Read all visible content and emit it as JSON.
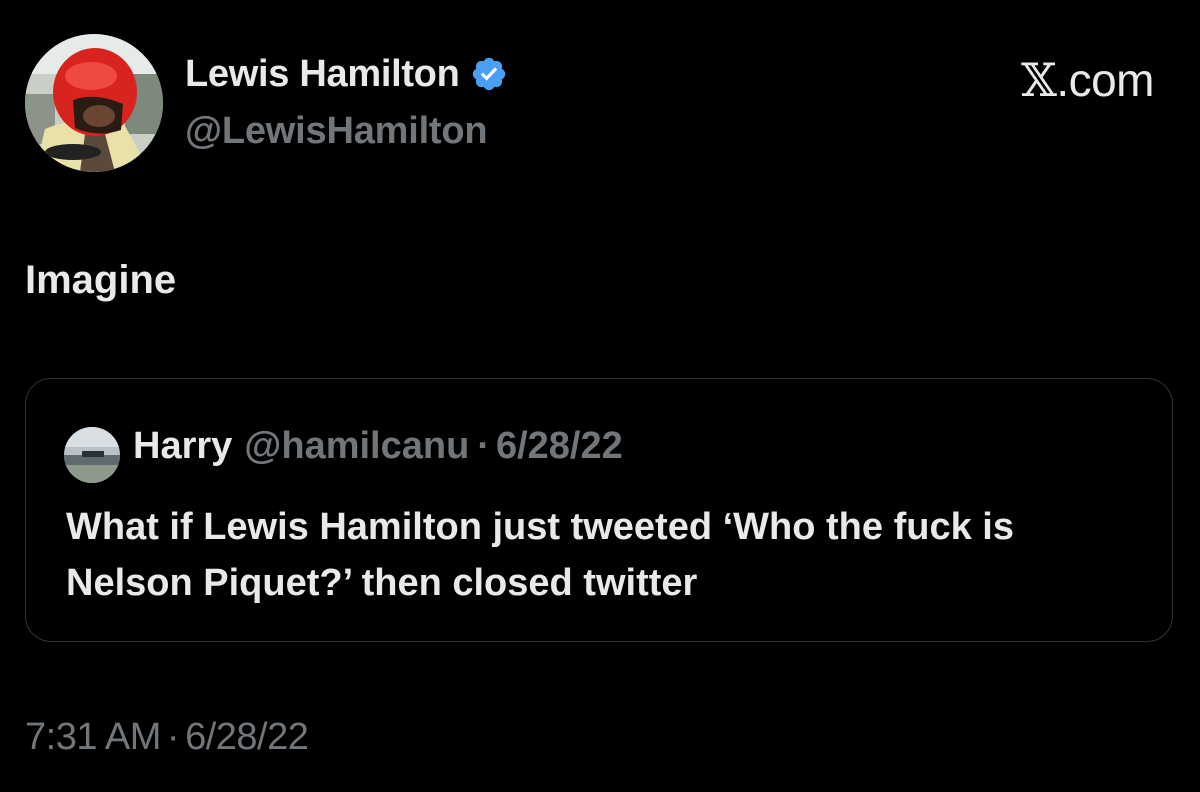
{
  "author": {
    "name": "Lewis Hamilton",
    "handle": "@LewisHamilton",
    "verified_icon": "verified-badge-icon",
    "verified_color": "#4a9ff5"
  },
  "site_label": {
    "glyph": "𝕏",
    "suffix": ".com"
  },
  "tweet": {
    "text": "Imagine",
    "time": "7:31 AM",
    "separator": "·",
    "date": "6/28/22"
  },
  "quote": {
    "name": "Harry",
    "handle": "@hamilcanu",
    "separator": "·",
    "date": "6/28/22",
    "text": "What if Lewis Hamilton just tweeted ‘Who the fuck is Nelson Piquet?’ then closed twitter"
  },
  "colors": {
    "background": "#000000",
    "primary_text": "#e7e9ea",
    "secondary_text": "#71767b",
    "border": "#2f3336"
  }
}
